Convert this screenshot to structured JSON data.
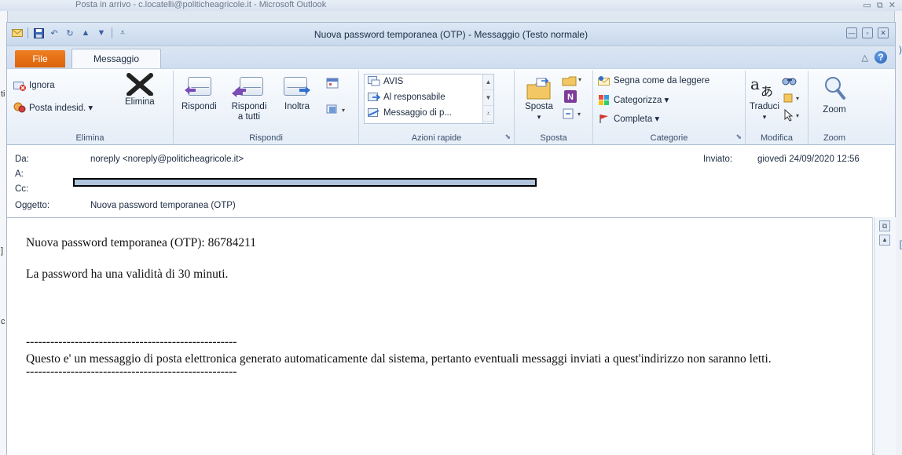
{
  "background_window": {
    "title": "Posta in arrivo - c.locatelli@politicheagricole.it - Microsoft Outlook",
    "left_edge_chars": [
      "ti",
      "]",
      "c"
    ],
    "right_edge_chars": [
      ")",
      "[",
      ")"
    ]
  },
  "window": {
    "title": "Nuova password temporanea (OTP) - Messaggio (Testo normale)",
    "controls": [
      "minimize-icon",
      "restore-icon",
      "close-icon"
    ]
  },
  "tabs": {
    "file": "File",
    "message": "Messaggio"
  },
  "ribbon": {
    "elimina": {
      "label": "Elimina",
      "ignora": "Ignora",
      "posta_indesid": "Posta indesid. ▾",
      "elimina_btn": "Elimina"
    },
    "rispondi": {
      "label": "Rispondi",
      "rispondi_btn": "Rispondi",
      "rispondi_tutti_line1": "Rispondi",
      "rispondi_tutti_line2": "a tutti",
      "inoltra": "Inoltra"
    },
    "azioni_rapide": {
      "label": "Azioni rapide",
      "items": [
        "AVIS",
        "Al responsabile",
        "Messaggio di p..."
      ]
    },
    "sposta": {
      "label": "Sposta",
      "sposta_btn": "Sposta",
      "sposta_arrow": "▾"
    },
    "categorie": {
      "label": "Categorie",
      "segna": "Segna come da leggere",
      "categorizza": "Categorizza ▾",
      "completa": "Completa ▾"
    },
    "modifica": {
      "label": "Modifica",
      "traduci": "Traduci",
      "traduci_arrow": "▾"
    },
    "zoom": {
      "label": "Zoom",
      "zoom_btn": "Zoom"
    }
  },
  "header": {
    "da_label": "Da:",
    "da_value": "noreply <noreply@politicheagricole.it>",
    "a_label": "A:",
    "cc_label": "Cc:",
    "oggetto_label": "Oggetto:",
    "oggetto_value": "Nuova password temporanea (OTP)",
    "inviato_label": "Inviato:",
    "inviato_value": "giovedì 24/09/2020 12:56"
  },
  "body": {
    "line1": "Nuova password temporanea (OTP): 86784211",
    "line2": "La password ha una validità di 30 minuti.",
    "separator": "----------------------------------------------------",
    "notice": "Questo e' un messaggio di posta elettronica generato automaticamente dal sistema, pertanto eventuali messaggi inviati a quest'indirizzo non saranno letti.",
    "separator2": "----------------------------------------------------"
  },
  "colors": {
    "file_tab": "#e26e14",
    "title_bar": "#d3e1f1",
    "redaction_fill": "#b0c4de"
  }
}
